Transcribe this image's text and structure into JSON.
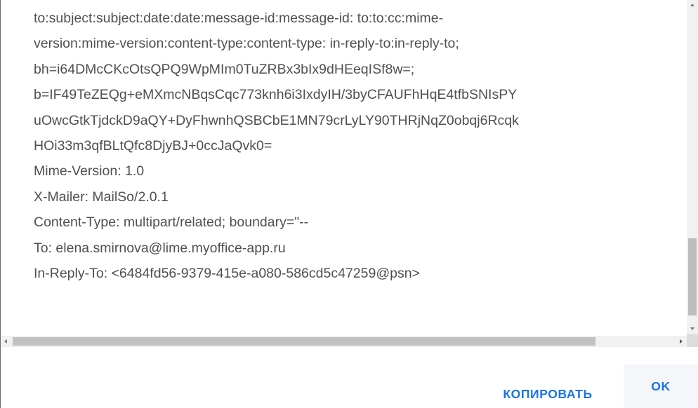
{
  "message_headers": [
    "to:subject:subject:date:date:message-id:message-id: to:to:cc:mime-",
    "version:mime-version:content-type:content-type: in-reply-to:in-reply-to;",
    "bh=i64DMcCKcOtsQPQ9WpMIm0TuZRBx3bIx9dHEeqISf8w=;",
    "b=IF49TeZEQg+eMXmcNBqsCqc773knh6i3IxdyIH/3byCFAUFhHqE4tfbSNIsPY",
    "uOwcGtkTjdckD9aQY+DyFhwnhQSBCbE1MN79crLyLY90THRjNqZ0obqj6Rcqk",
    "HOi33m3qfBLtQfc8DjyBJ+0ccJaQvk0=",
    "Mime-Version: 1.0",
    "X-Mailer: MailSo/2.0.1",
    "Content-Type: multipart/related; boundary=\"--",
    "To: elena.smirnova@lime.myoffice-app.ru",
    "In-Reply-To: <6484fd56-9379-415e-a080-586cd5c47259@psn>"
  ],
  "footer": {
    "copy_label": "КОПИРОВАТЬ",
    "ok_label": "OK"
  },
  "colors": {
    "text": "#505050",
    "accent": "#1a73e8",
    "scrollbar_track": "#f1f1f1",
    "scrollbar_thumb": "#bdbdbd"
  },
  "icons": {
    "scroll_up": "triangle-up-icon",
    "scroll_down": "triangle-down-icon",
    "scroll_left": "triangle-left-icon",
    "scroll_right": "triangle-right-icon"
  }
}
